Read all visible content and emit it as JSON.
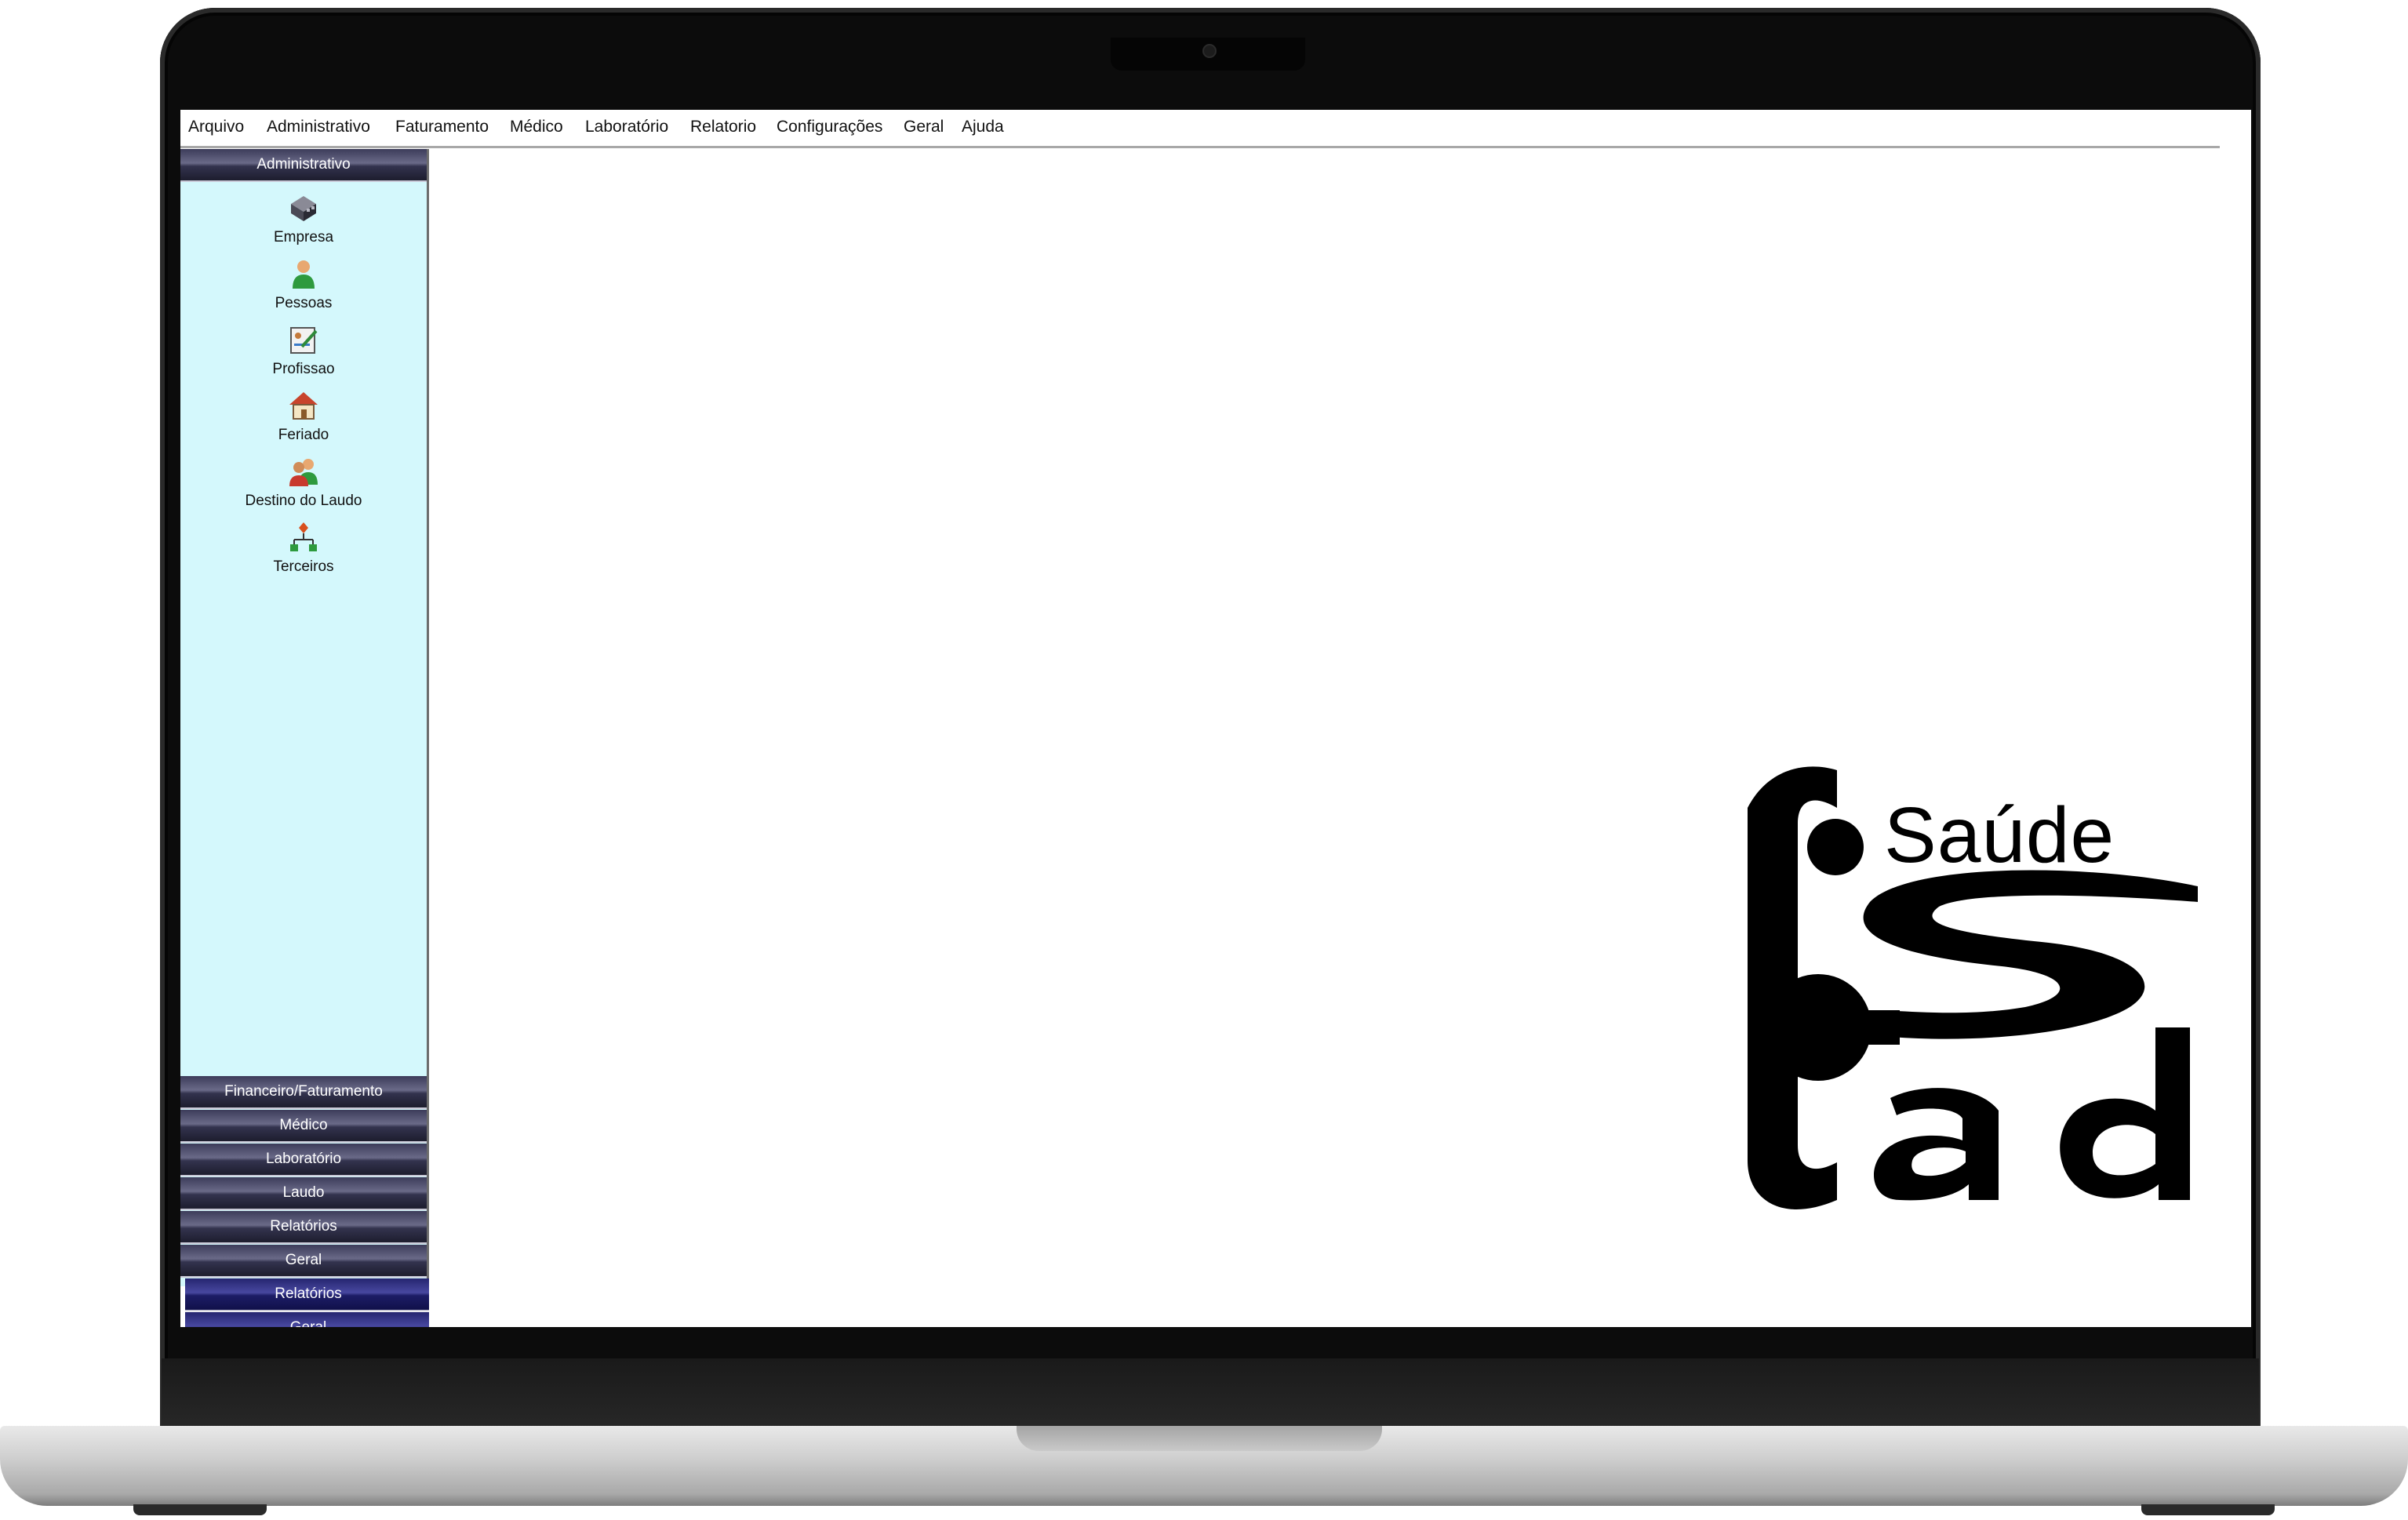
{
  "menu": {
    "items": [
      "Arquivo",
      "Administrativo",
      "Faturamento",
      "Médico",
      "Laboratório",
      "Relatorio",
      "Configurações",
      "Geral",
      "Ajuda"
    ]
  },
  "sidebar": {
    "header": "Administrativo",
    "tools": [
      {
        "label": "Empresa",
        "icon": "building-icon"
      },
      {
        "label": "Pessoas",
        "icon": "person-icon"
      },
      {
        "label": "Profissao",
        "icon": "document-edit-icon"
      },
      {
        "label": "Feriado",
        "icon": "house-icon"
      },
      {
        "label": "Destino do Laudo",
        "icon": "people-icon"
      },
      {
        "label": "Terceiros",
        "icon": "org-chart-icon"
      }
    ],
    "groups": [
      "Financeiro/Faturamento",
      "Médico",
      "Laboratório",
      "Laudo",
      "Relatórios",
      "Geral",
      "Relatórios",
      "Geral"
    ]
  },
  "logo": {
    "text": "Saúde",
    "colors": {
      "mark": "#000000"
    }
  },
  "colors": {
    "sidebar_bg": "#d4f8fc",
    "group_header": "#33334e",
    "group_header_alt": "#1d1d66"
  }
}
